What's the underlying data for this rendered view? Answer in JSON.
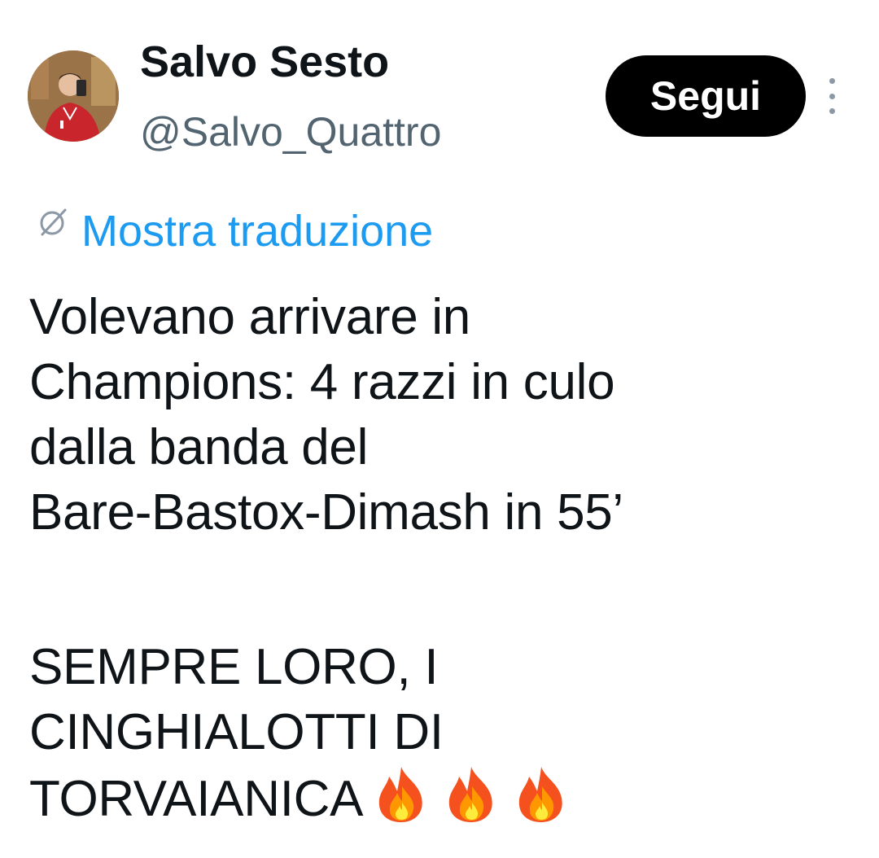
{
  "author": {
    "display_name": "Salvo Sesto",
    "handle": "@Salvo_Quattro",
    "avatar_icon": "profile-photo"
  },
  "follow_button": {
    "label": "Segui",
    "color": "#000000"
  },
  "more_menu": {
    "icon": "more-vertical-icon"
  },
  "translate": {
    "label": "Mostra traduzione",
    "icon": "translate-globe-icon",
    "color": "#1d9bf0"
  },
  "tweet": {
    "paragraph_1": "Volevano arrivare in\nChampions: 4 razzi in culo\ndalla banda del\nBare-Bastox-Dimash in 55’",
    "paragraph_2": "SEMPRE LORO, I\nCINGHIALOTTI DI\nTORVAIANICA",
    "emoji": [
      "fire-icon",
      "fire-icon",
      "fire-icon"
    ]
  }
}
